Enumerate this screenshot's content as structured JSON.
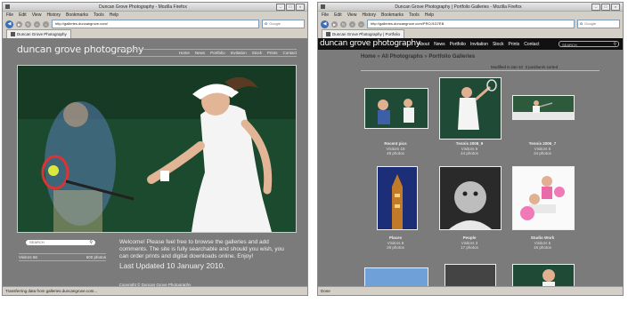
{
  "left_window": {
    "title": "Duncan Grove Photography - Mozilla Firefox",
    "menu": [
      "File",
      "Edit",
      "View",
      "History",
      "Bookmarks",
      "Tools",
      "Help"
    ],
    "url": "http://galleries.duncangrove.com/",
    "search_engine": "Google",
    "tab": "Duncan Grove Photography",
    "status": "Transferring data from galleries.duncangrove.com...",
    "site": {
      "title": "duncan grove photography",
      "nav": [
        "Home",
        "News",
        "Portfolio",
        "Invitation",
        "Stock",
        "Prints",
        "Contact"
      ],
      "search_placeholder": "SEARCH",
      "visitors_label": "Visitors 66",
      "photos_label": "600 photos",
      "welcome": "Welcome! Please feel free to browse the galleries and add comments. The site is fully searchable and should you wish, you can order prints and digital downloads online. Enjoy!",
      "updated": "Last Updated 10 January 2010.",
      "copyright": "Copyright © Duncan Grove Photography"
    }
  },
  "right_window": {
    "title": "Duncan Grove Photography | Portfolio Galleries - Mozilla Firefox",
    "menu": [
      "File",
      "Edit",
      "View",
      "History",
      "Bookmarks",
      "Tools",
      "Help"
    ],
    "url": "http://galleries.duncangrove.com/PROJ1D7EB",
    "search_engine": "Google",
    "tab": "Duncan Grove Photography | Portfolio",
    "status": "Done",
    "site": {
      "title": "duncan grove photography",
      "nav": [
        "About",
        "News",
        "Portfolio",
        "Invitation",
        "Stock",
        "Prints",
        "Contact"
      ],
      "search_placeholder": "SEARCH",
      "breadcrumb": [
        "Home",
        "All Photographs",
        "Portfolio Galleries"
      ],
      "modified": "Modified 6-Jan-10",
      "sort_label": "3 position/s sorted",
      "galleries": [
        {
          "name": "Recent pics",
          "visitors": "Visitors 18",
          "photos": "48 photos"
        },
        {
          "name": "Tennis 2008_9",
          "visitors": "Visitors 6",
          "photos": "44 photos"
        },
        {
          "name": "Tennis 2006_7",
          "visitors": "Visitors 5",
          "photos": "34 photos"
        },
        {
          "name": "Places",
          "visitors": "Visitors 8",
          "photos": "28 photos"
        },
        {
          "name": "People",
          "visitors": "Visitors 3",
          "photos": "17 photos"
        },
        {
          "name": "Studio Work",
          "visitors": "Visitors 5",
          "photos": "16 photos"
        }
      ]
    }
  },
  "colors": {
    "page_gray": "#7b7b7b",
    "court_green": "#1b3d28",
    "header_black": "#111111"
  }
}
